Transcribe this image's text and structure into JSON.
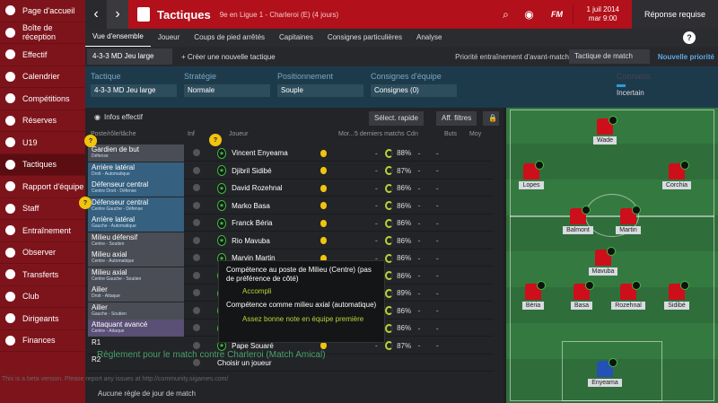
{
  "sidebar": {
    "items": [
      {
        "label": "Page d'accueil",
        "icon": "home-icon"
      },
      {
        "label": "Boîte de réception",
        "icon": "inbox-icon"
      },
      {
        "label": "Effectif",
        "icon": "squad-icon"
      },
      {
        "label": "Calendrier",
        "icon": "calendar-icon"
      },
      {
        "label": "Compétitions",
        "icon": "trophy-icon"
      },
      {
        "label": "Réserves",
        "icon": "reserves-icon"
      },
      {
        "label": "U19",
        "icon": "youth-icon"
      },
      {
        "label": "Tactiques",
        "icon": "tactics-icon"
      },
      {
        "label": "Rapport d'équipe",
        "icon": "report-icon"
      },
      {
        "label": "Staff",
        "icon": "staff-icon"
      },
      {
        "label": "Entraînement",
        "icon": "training-icon"
      },
      {
        "label": "Observer",
        "icon": "scouting-icon"
      },
      {
        "label": "Transferts",
        "icon": "transfer-icon"
      },
      {
        "label": "Club",
        "icon": "club-icon"
      },
      {
        "label": "Dirigeants",
        "icon": "board-icon"
      },
      {
        "label": "Finances",
        "icon": "finance-icon"
      }
    ]
  },
  "header": {
    "title": "Tactiques",
    "subtitle": "9e en Ligue 1 - Charleroi (E) (4 jours)",
    "date": "1 juil 2014",
    "time": "mar 9:00",
    "continue_label": "Réponse requise",
    "fm_label": "FM"
  },
  "subnav": {
    "items": [
      "Vue d'ensemble",
      "Joueur",
      "Coups de pied arrêtés",
      "Capitaines",
      "Consignes particulières",
      "Analyse"
    ],
    "help": "?"
  },
  "tactic_bar": {
    "formation": "4-3-3 MD Jeu large",
    "create": "Créer une nouvelle tactique",
    "priority": "Priorité entraînement d'avant-match",
    "match_tactic": "Tactique de match",
    "new_priority": "Nouvelle priorité"
  },
  "settings": {
    "tactic_label": "Tactique",
    "tactic_value": "4-3-3 MD Jeu large",
    "strategy_label": "Stratégie",
    "strategy_value": "Normale",
    "position_label": "Positionnement",
    "position_value": "Souple",
    "instructions_label": "Consignes d'équipe",
    "instructions_value": "Consignes (0)",
    "knowledge_label": "Connaiss.",
    "knowledge_value": "Incertain"
  },
  "filters": {
    "info": "Infos effectif",
    "quick_select": "Sélect. rapide",
    "filters": "Aff. filtres"
  },
  "columns": {
    "role": "Poste/rôle/tâche",
    "inf": "Inf",
    "player": "Joueur",
    "morale": "Mor...",
    "last5": "5 derniers matchs",
    "cond": "Cdn",
    "goals": "Buts",
    "avg": "Moy"
  },
  "rows": [
    {
      "role": "Gardien de but",
      "duty": "Défense",
      "type": "mid",
      "player": "Vincent Enyeama",
      "cond": "88%"
    },
    {
      "role": "Arrière latéral",
      "duty": "Droit - Automatique",
      "type": "def",
      "player": "Djibril Sidibé",
      "cond": "87%"
    },
    {
      "role": "Défenseur central",
      "duty": "Centre Droit - Défense",
      "type": "def",
      "player": "David Rozehnal",
      "cond": "86%"
    },
    {
      "role": "Défenseur central",
      "duty": "Centre Gauche - Défense",
      "type": "def",
      "player": "Marko Basa",
      "cond": "86%"
    },
    {
      "role": "Arrière latéral",
      "duty": "Gauche - Automatique",
      "type": "def",
      "player": "Franck Béria",
      "cond": "86%"
    },
    {
      "role": "Milieu défensif",
      "duty": "Centre - Soutien",
      "type": "mid",
      "player": "Rio Mavuba",
      "cond": "86%"
    },
    {
      "role": "Milieu axial",
      "duty": "Centre - Automatique",
      "type": "mid",
      "player": "Marvin Martin",
      "cond": "86%"
    },
    {
      "role": "Milieu axial",
      "duty": "Centre Gauche - Soutien",
      "type": "mid",
      "player": "",
      "cond": "86%"
    },
    {
      "role": "Ailier",
      "duty": "Droit - Attaque",
      "type": "mid",
      "player": "",
      "cond": "89%"
    },
    {
      "role": "Ailier",
      "duty": "Gauche - Soutien",
      "type": "mid",
      "player": "",
      "cond": "86%"
    },
    {
      "role": "Attaquant avancé",
      "duty": "Centre - Attaque",
      "type": "att",
      "player": "",
      "cond": "86%"
    },
    {
      "role": "R1",
      "duty": "",
      "type": "sub",
      "player": "Pape Souaré",
      "cond": "87%"
    },
    {
      "role": "R2",
      "duty": "",
      "type": "sub",
      "player": "Choisir un joueur",
      "cond": ""
    }
  ],
  "tooltip": {
    "line1": "Compétence au poste de Milieu (Centre) (pas de préférence de côté)",
    "val1": "Accompli",
    "line2": "Compétence comme milieu axial (automatique)",
    "val2": "Assez bonne note en équipe première"
  },
  "match_rule": "Règlement pour le match contre Charleroi (Match Amical)",
  "no_rule": "Aucune règle de jour de match",
  "beta": "This is a beta version. Please report any issues at http://community.sigames.com/",
  "pitch": {
    "players": [
      {
        "name": "Wade"
      },
      {
        "name": "Lopes"
      },
      {
        "name": "Corchia"
      },
      {
        "name": "Balmont"
      },
      {
        "name": "Martin"
      },
      {
        "name": "Mavuba"
      },
      {
        "name": "Béria"
      },
      {
        "name": "Basa"
      },
      {
        "name": "Rozehnal"
      },
      {
        "name": "Sidibé"
      },
      {
        "name": "Enyeama"
      }
    ]
  }
}
